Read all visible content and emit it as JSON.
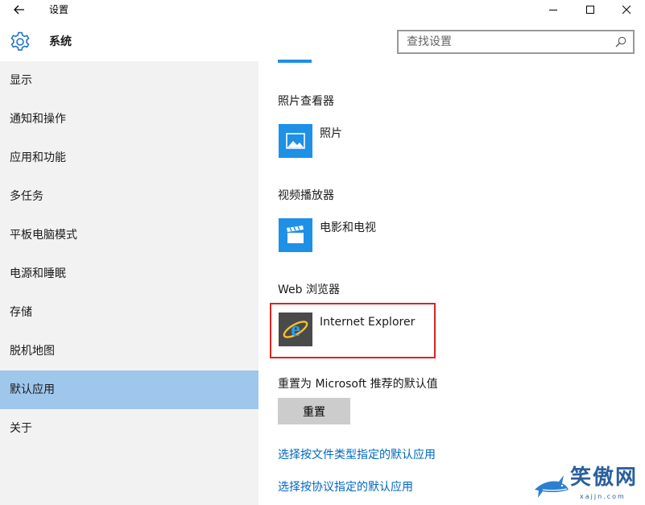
{
  "window": {
    "title": "设置",
    "section_title": "系统",
    "controls": [
      "minimize-icon",
      "maximize-icon",
      "close-icon"
    ]
  },
  "search": {
    "placeholder": "查找设置",
    "value": ""
  },
  "sidebar": {
    "items": [
      {
        "label": "显示"
      },
      {
        "label": "通知和操作"
      },
      {
        "label": "应用和功能"
      },
      {
        "label": "多任务"
      },
      {
        "label": "平板电脑模式"
      },
      {
        "label": "电源和睡眠"
      },
      {
        "label": "存储"
      },
      {
        "label": "脱机地图"
      },
      {
        "label": "默认应用",
        "selected": true
      },
      {
        "label": "关于"
      }
    ]
  },
  "content": {
    "photo_viewer": {
      "heading": "照片查看器",
      "app": "照片",
      "icon": "photos-icon"
    },
    "video_player": {
      "heading": "视频播放器",
      "app": "电影和电视",
      "icon": "movies-tv-icon"
    },
    "web_browser": {
      "heading": "Web 浏览器",
      "app": "Internet Explorer",
      "icon": "internet-explorer-icon"
    },
    "reset": {
      "heading": "重置为 Microsoft 推荐的默认值",
      "button": "重置"
    },
    "links": [
      {
        "label": "选择按文件类型指定的默认应用"
      },
      {
        "label": "选择按协议指定的默认应用"
      }
    ]
  },
  "watermark": {
    "text": "笑傲网",
    "sub": "xajjn.com"
  },
  "colors": {
    "accent": "#1e90e6",
    "selected_nav": "#9fc6eb",
    "highlight_border": "#d9241f",
    "link": "#0067c0"
  }
}
